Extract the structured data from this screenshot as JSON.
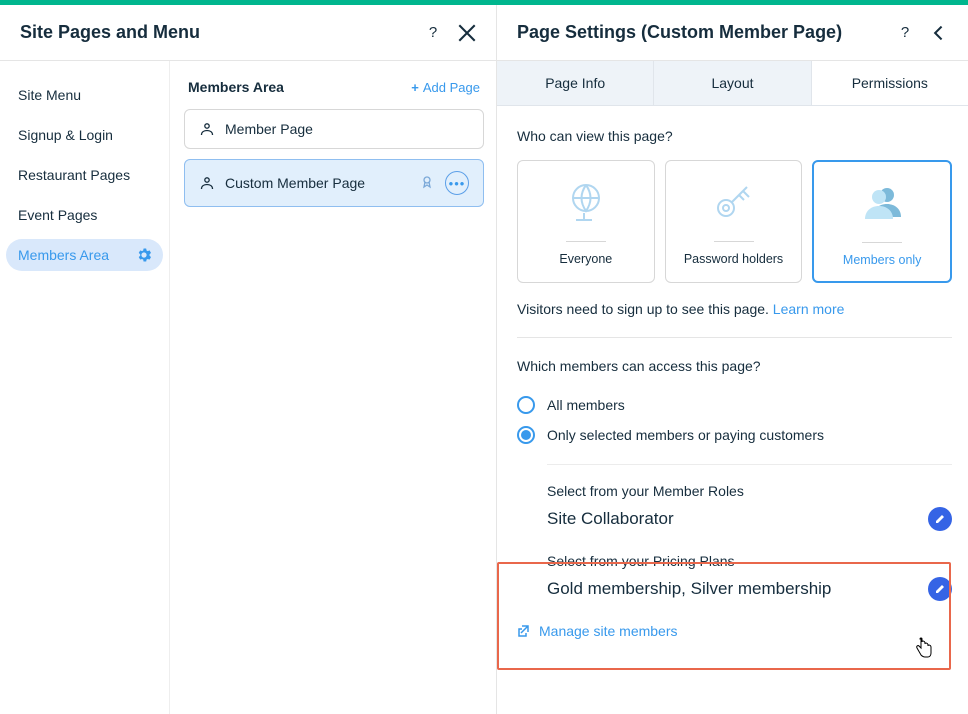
{
  "left": {
    "title": "Site Pages and Menu",
    "sidebar": {
      "items": [
        {
          "label": "Site Menu"
        },
        {
          "label": "Signup & Login"
        },
        {
          "label": "Restaurant Pages"
        },
        {
          "label": "Event Pages"
        },
        {
          "label": "Members Area"
        }
      ]
    },
    "pageList": {
      "title": "Members Area",
      "addLabel": "Add Page",
      "items": [
        {
          "label": "Member Page"
        },
        {
          "label": "Custom Member Page"
        }
      ]
    }
  },
  "right": {
    "title": "Page Settings (Custom Member Page)",
    "tabs": [
      {
        "label": "Page Info"
      },
      {
        "label": "Layout"
      },
      {
        "label": "Permissions"
      }
    ],
    "whoCanView": {
      "label": "Who can view this page?",
      "options": [
        {
          "label": "Everyone"
        },
        {
          "label": "Password holders"
        },
        {
          "label": "Members only"
        }
      ],
      "hint": "Visitors need to sign up to see this page. ",
      "hintLink": "Learn more"
    },
    "whichMembers": {
      "label": "Which members can access this page?",
      "options": [
        {
          "label": "All members"
        },
        {
          "label": "Only selected members or paying customers"
        }
      ]
    },
    "memberRoles": {
      "label": "Select from your Member Roles",
      "value": "Site Collaborator"
    },
    "pricingPlans": {
      "label": "Select from your Pricing Plans",
      "value": "Gold membership, Silver membership"
    },
    "manageLink": "Manage site members"
  }
}
